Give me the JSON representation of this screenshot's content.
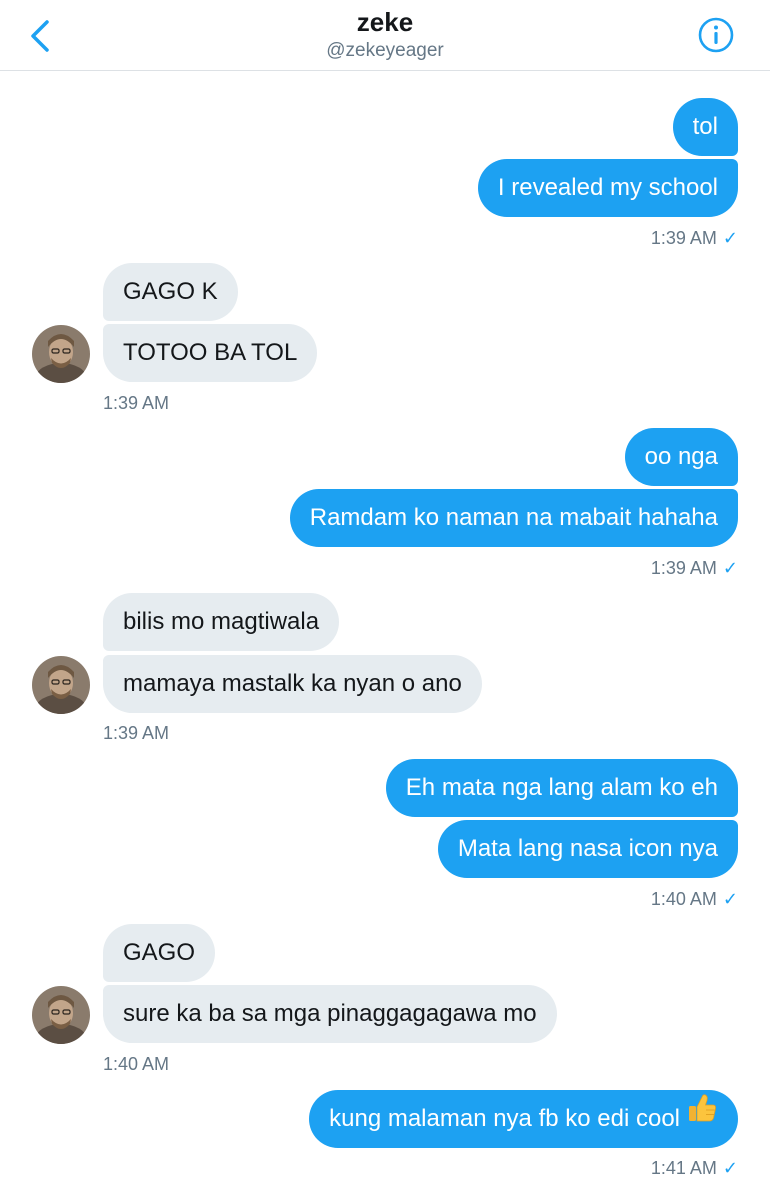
{
  "header": {
    "title": "zeke",
    "handle": "@zekeyeager"
  },
  "messages": [
    {
      "text": "tol"
    },
    {
      "text": "I revealed my school"
    },
    {
      "time": "1:39 AM"
    },
    {
      "text": "GAGO K"
    },
    {
      "text": "TOTOO BA TOL"
    },
    {
      "time": "1:39 AM"
    },
    {
      "text": "oo nga"
    },
    {
      "text": "Ramdam ko naman na mabait hahaha"
    },
    {
      "time": "1:39 AM"
    },
    {
      "text": "bilis mo magtiwala"
    },
    {
      "text": "mamaya mastalk ka nyan o ano"
    },
    {
      "time": "1:39 AM"
    },
    {
      "text": "Eh mata nga lang alam ko eh"
    },
    {
      "text": "Mata lang nasa icon nya"
    },
    {
      "time": "1:40 AM"
    },
    {
      "text": "GAGO"
    },
    {
      "text": "sure ka ba sa mga pinaggagagawa mo"
    },
    {
      "time": "1:40 AM"
    },
    {
      "text": "kung malaman nya fb ko edi cool",
      "emoji": "thumbs-up-icon"
    },
    {
      "time": "1:41 AM"
    }
  ],
  "colors": {
    "accent": "#1da1f2",
    "incoming_bubble": "#e6ecf0",
    "secondary_text": "#657786"
  }
}
